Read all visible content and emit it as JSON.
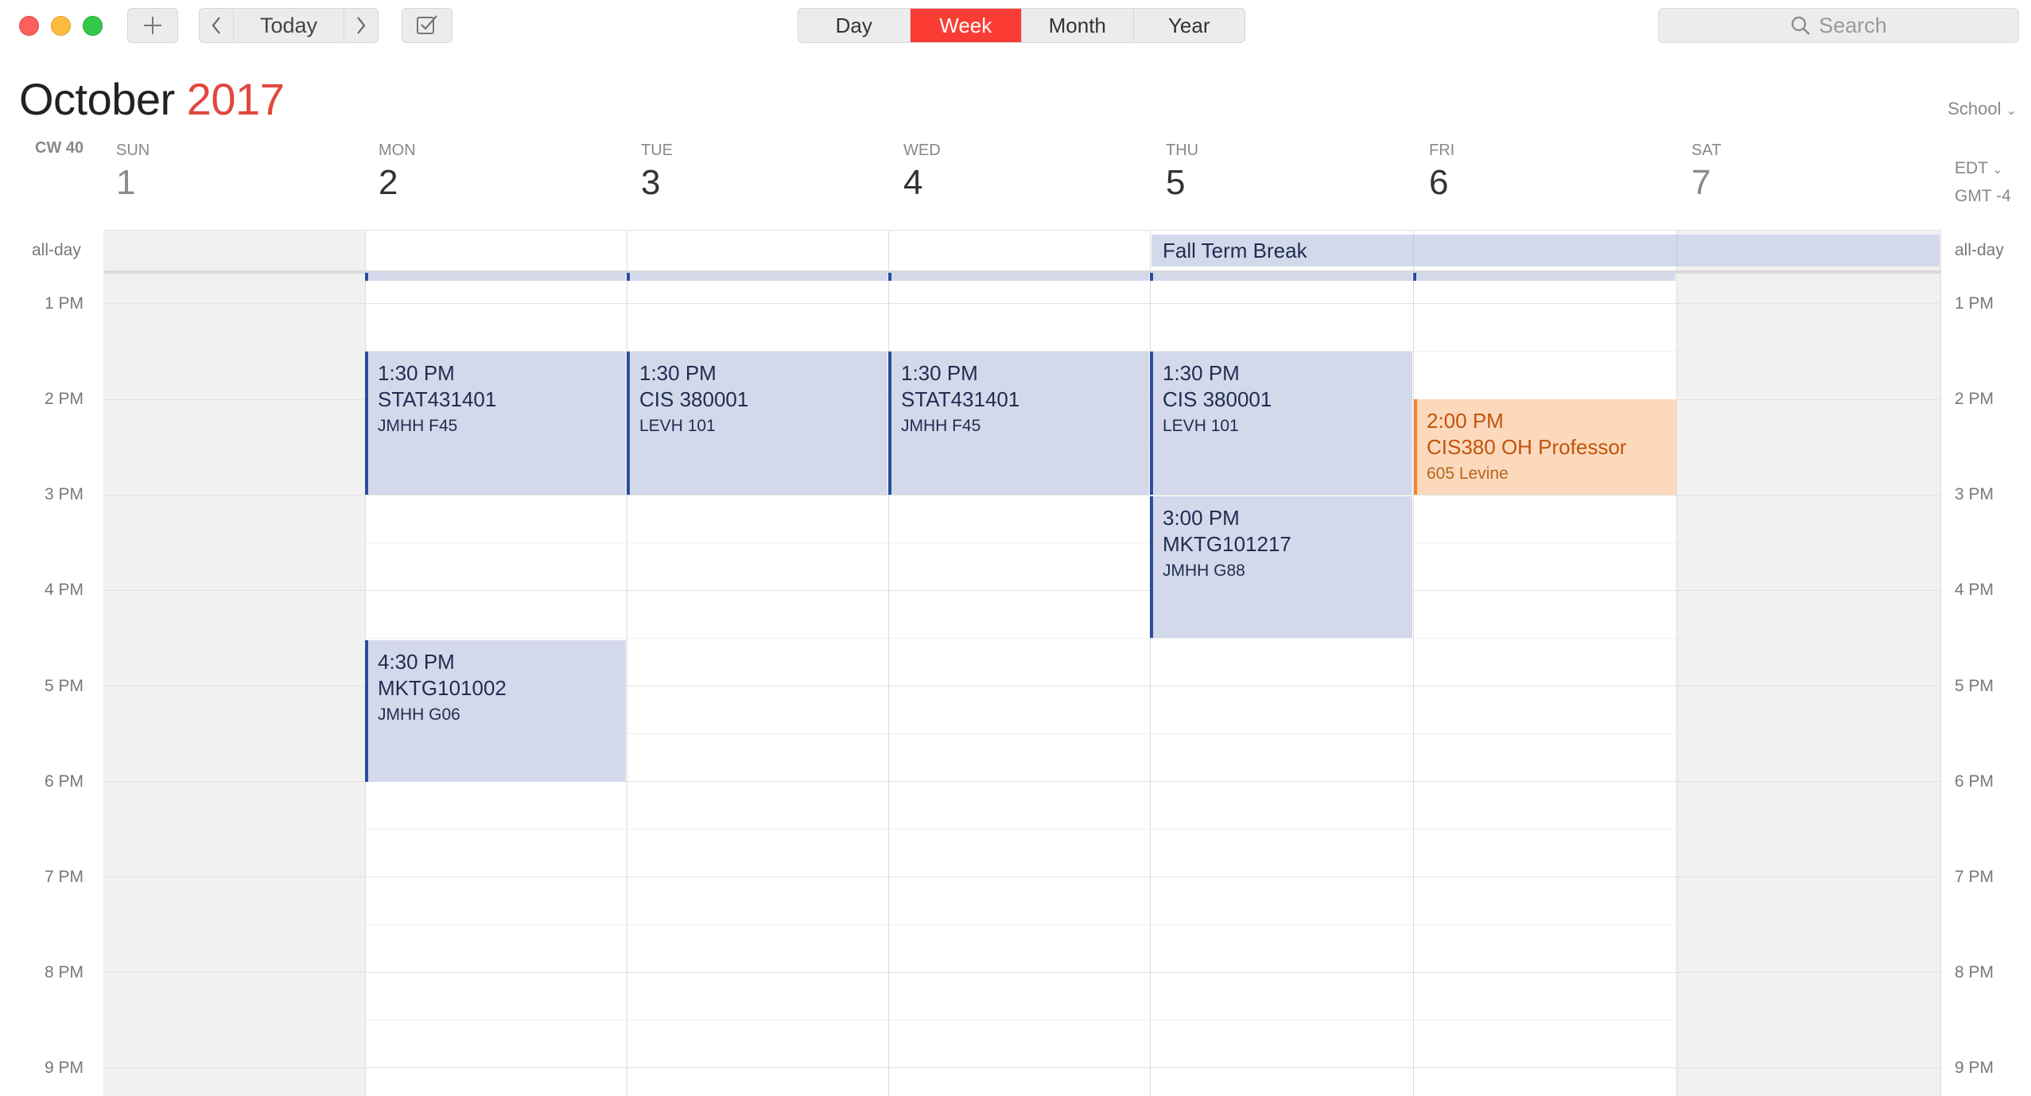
{
  "toolbar": {
    "today_label": "Today",
    "views": [
      {
        "label": "Day",
        "active": false
      },
      {
        "label": "Week",
        "active": true
      },
      {
        "label": "Month",
        "active": false
      },
      {
        "label": "Year",
        "active": false
      }
    ],
    "search_placeholder": "Search",
    "icons": {
      "add": "plus-icon",
      "prev": "chevron-left-icon",
      "next": "chevron-right-icon",
      "tasks": "checkbox-icon",
      "search": "magnifier-icon"
    }
  },
  "header": {
    "month": "October",
    "year": "2017",
    "calendar_menu": "School",
    "calendar_week": "CW 40",
    "timezone_name": "EDT",
    "timezone_offset": "GMT -4"
  },
  "days": [
    {
      "dow": "SUN",
      "num": "1"
    },
    {
      "dow": "MON",
      "num": "2"
    },
    {
      "dow": "TUE",
      "num": "3"
    },
    {
      "dow": "WED",
      "num": "4"
    },
    {
      "dow": "THU",
      "num": "5"
    },
    {
      "dow": "FRI",
      "num": "6"
    },
    {
      "dow": "SAT",
      "num": "7"
    }
  ],
  "allday_label": "all-day",
  "hours": [
    "1 PM",
    "2 PM",
    "3 PM",
    "4 PM",
    "5 PM",
    "6 PM",
    "7 PM",
    "8 PM",
    "9 PM"
  ],
  "allday_events": [
    {
      "title": "Fall Term Break"
    }
  ],
  "events": [
    {
      "time": "1:30 PM",
      "title": "STAT431401",
      "location": "JMHH F45"
    },
    {
      "time": "1:30 PM",
      "title": "CIS 380001",
      "location": "LEVH 101"
    },
    {
      "time": "1:30 PM",
      "title": "STAT431401",
      "location": "JMHH F45"
    },
    {
      "time": "1:30 PM",
      "title": "CIS 380001",
      "location": "LEVH 101"
    },
    {
      "time": "3:00 PM",
      "title": "MKTG101217",
      "location": "JMHH G88"
    },
    {
      "time": "4:30 PM",
      "title": "MKTG101002",
      "location": "JMHH G06"
    },
    {
      "time": "2:00 PM",
      "title": "CIS380 OH Professor",
      "location": "605 Levine"
    }
  ],
  "colors": {
    "accent": "#fa3c34",
    "event_blue": "#d3d9ea",
    "event_blue_border": "#2a4d9f",
    "event_orange": "#fcd9bd",
    "event_orange_border": "#f5822c",
    "year_red": "#e0483e"
  }
}
